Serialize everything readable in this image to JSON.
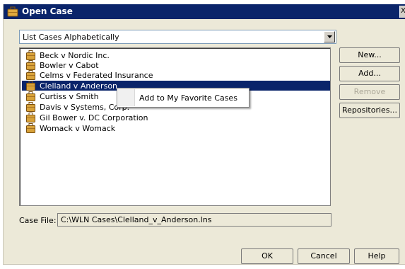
{
  "window": {
    "title": "Open Case",
    "close_glyph": "X"
  },
  "sort_select": {
    "value": "List Cases Alphabetically"
  },
  "cases": [
    {
      "label": "Beck v Nordic Inc.",
      "selected": false
    },
    {
      "label": "Bowler v Cabot",
      "selected": false
    },
    {
      "label": "Celms v Federated Insurance",
      "selected": false
    },
    {
      "label": "Clelland v Anderson",
      "selected": true
    },
    {
      "label": "Curtiss v Smith",
      "selected": false
    },
    {
      "label": "Davis v Systems, Corp.",
      "selected": false
    },
    {
      "label": "Gil Bower v. DC Corporation",
      "selected": false
    },
    {
      "label": "Womack v Womack",
      "selected": false
    }
  ],
  "context_menu": {
    "item": "Add to My Favorite Cases"
  },
  "side_buttons": {
    "new_label": "New...",
    "add_label": "Add...",
    "remove_label": "Remove",
    "repositories_label": "Repositories..."
  },
  "case_file": {
    "label": "Case File:",
    "value": "C:\\WLN Cases\\Clelland_v_Anderson.lns"
  },
  "bottom_buttons": {
    "ok_label": "OK",
    "cancel_label": "Cancel",
    "help_label": "Help"
  },
  "colors": {
    "selection": "#0a246a",
    "dialog_bg": "#ece9d8",
    "case_icon": "#d8a23a"
  },
  "icons": {
    "title": "briefcase-icon",
    "case": "briefcase-icon",
    "dropdown": "chevron-down-icon"
  }
}
